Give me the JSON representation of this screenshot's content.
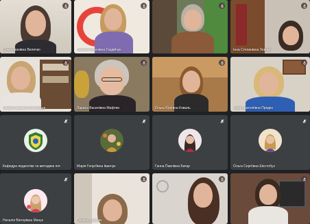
{
  "colors": {
    "page_bg": "#202124",
    "tile_bg": "#3c4043",
    "mic_off": "#ea4335",
    "label": "#ffffff"
  },
  "participants": [
    {
      "name": "Ольга Іванівна Величко",
      "mic": "muted"
    },
    {
      "name": "Оксана Євгенівна Гордійчук",
      "mic": "muted"
    },
    {
      "name": "",
      "mic": "muted"
    },
    {
      "name": "Інна Степанівна Левчук",
      "mic": "muted"
    },
    {
      "name": "Оксана Іванівна Костецька",
      "mic": "muted"
    },
    {
      "name": "Лариса Василівна Мафтин",
      "mic": "muted"
    },
    {
      "name": "Ольга Юріївна Коваль",
      "mic": "muted"
    },
    {
      "name": "Лілія Анатоліївна Прядко",
      "mic": "muted"
    },
    {
      "name": "Кафедра педагогіки та методики початкової...",
      "mic": "muted"
    },
    {
      "name": "Марія Георгіївна Іванчук",
      "mic": "muted"
    },
    {
      "name": "Ганна Павлівна Бигар",
      "mic": "muted"
    },
    {
      "name": "Ольга Сергіївна Шестобуз",
      "mic": "muted"
    },
    {
      "name": "Наталія Вікторівна Мачук",
      "mic": "muted"
    },
    {
      "name": "Оксана Зозуляк",
      "mic": "muted"
    },
    {
      "name": "",
      "mic": "muted"
    },
    {
      "name": "",
      "mic": "muted"
    }
  ]
}
